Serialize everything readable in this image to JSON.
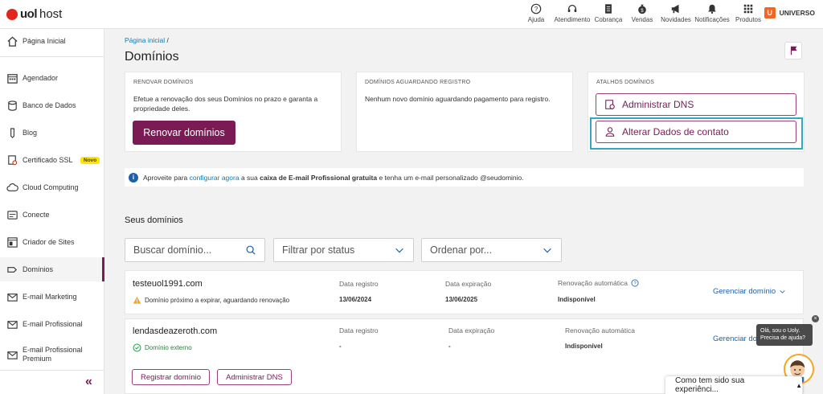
{
  "brand": {
    "logo_part1": "uol",
    "logo_part2": "host"
  },
  "topnav": [
    {
      "label": "Ajuda",
      "icon": "help-circle-icon"
    },
    {
      "label": "Atendimento",
      "icon": "headset-icon"
    },
    {
      "label": "Cobrança",
      "icon": "document-icon"
    },
    {
      "label": "Vendas",
      "icon": "money-bag-icon"
    },
    {
      "label": "Novidades",
      "icon": "megaphone-icon"
    },
    {
      "label": "Notificações",
      "icon": "bell-icon"
    },
    {
      "label": "Produtos",
      "icon": "grid-icon"
    }
  ],
  "universo": {
    "badge": "U",
    "label": "UNIVERSO"
  },
  "sidebar": {
    "items": [
      {
        "label": "Página Inicial",
        "icon": "home-icon"
      },
      {
        "label": "Agendador",
        "icon": "calendar-icon"
      },
      {
        "label": "Banco de Dados",
        "icon": "database-icon"
      },
      {
        "label": "Blog",
        "icon": "pen-icon"
      },
      {
        "label": "Certificado SSL",
        "icon": "certificate-icon",
        "badge": "Novo"
      },
      {
        "label": "Cloud Computing",
        "icon": "cloud-icon"
      },
      {
        "label": "Conecte",
        "icon": "connect-icon"
      },
      {
        "label": "Criador de Sites",
        "icon": "site-builder-icon"
      },
      {
        "label": "Domínios",
        "icon": "domain-icon",
        "active": true
      },
      {
        "label": "E-mail Marketing",
        "icon": "mail-marketing-icon"
      },
      {
        "label": "E-mail Profissional",
        "icon": "mail-icon"
      },
      {
        "label": "E-mail Profissional Premium",
        "icon": "mail-premium-icon"
      }
    ]
  },
  "breadcrumb": {
    "home": "Página inicial",
    "separator": "/"
  },
  "page_title": "Domínios",
  "cards": {
    "renew": {
      "title": "RENOVAR DOMÍNIOS",
      "text": "Efetue a renovação dos seus Domínios no prazo e garanta a propriedade deles.",
      "button": "Renovar domínios"
    },
    "pending": {
      "title": "DOMÍNIOS AGUARDANDO REGISTRO",
      "text": "Nenhum novo domínio aguardando pagamento para registro."
    },
    "shortcuts": {
      "title": "ATALHOS DOMÍNIOS",
      "dns": "Administrar DNS",
      "contact": "Alterar Dados de contato"
    }
  },
  "info_bar": {
    "prefix": "Aproveite para",
    "link": "configurar agora",
    "middle": "a sua",
    "bold": "caixa de E-mail Profissional gratuita",
    "suffix": "e tenha um e-mail personalizado @seudominio."
  },
  "domains_section": {
    "title": "Seus domínios",
    "search_placeholder": "Buscar domínio...",
    "filter_label": "Filtrar por status",
    "order_label": "Ordenar por..."
  },
  "domains": [
    {
      "name": "testeuol1991.com",
      "status": "Domínio próximo a expirar, aguardando renovação",
      "reg_label": "Data registro",
      "reg_value": "13/06/2024",
      "exp_label": "Data expiração",
      "exp_value": "13/06/2025",
      "auto_label": "Renovação automática",
      "auto_value": "Indisponível",
      "manage": "Gerenciar domínio"
    },
    {
      "name": "lendasdeazeroth.com",
      "status": "Domínio externo",
      "reg_label": "Data registro",
      "reg_value": "-",
      "exp_label": "Data expiração",
      "exp_value": "-",
      "auto_label": "Renovação automática",
      "auto_value": "Indisponível",
      "manage": "Gerenciar do",
      "btn_register": "Registrar domínio",
      "btn_dns": "Administrar DNS"
    }
  ],
  "chat": {
    "tooltip_line1": "Olá, sou o Uoly.",
    "tooltip_line2": "Precisa de ajuda?",
    "close": "×"
  },
  "feedback": {
    "label": "Como tem sido sua experiênci..."
  },
  "colors": {
    "brand": "#7a1b56",
    "link": "#0b7bb5",
    "focus": "#31a9c4",
    "warning": "#f5a623",
    "success": "#2e9e4f"
  }
}
